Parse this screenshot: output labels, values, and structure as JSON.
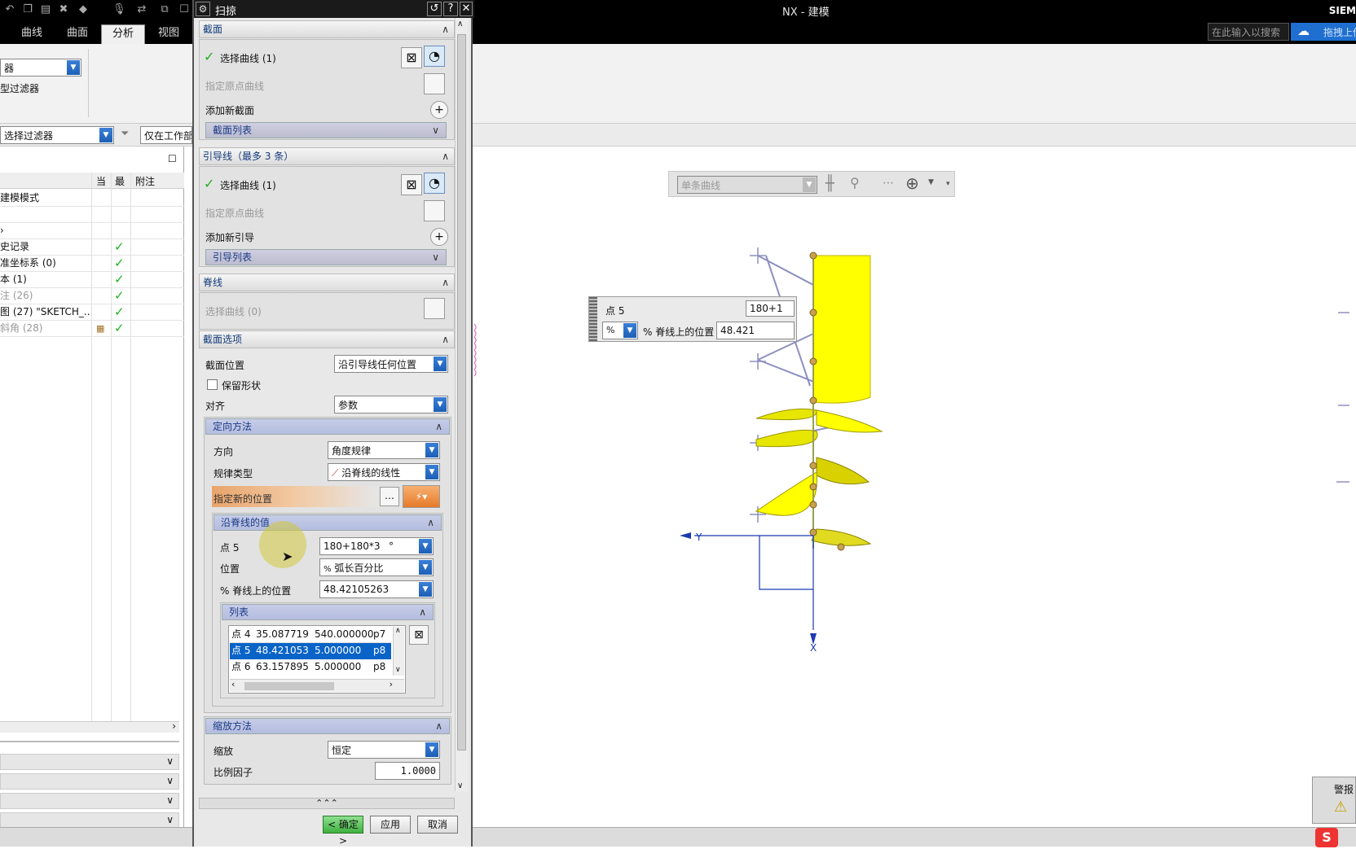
{
  "window": {
    "app_title": "NX - 建模",
    "brand": "SIEM",
    "search_placeholder": "在此输入以搜索",
    "cloud_label": "拖拽上传"
  },
  "ribbon": {
    "tabs": [
      {
        "label": "曲线",
        "active": false
      },
      {
        "label": "曲面",
        "active": false
      },
      {
        "label": "分析",
        "active": true
      },
      {
        "label": "视图",
        "active": false
      }
    ],
    "filter_combo": "器",
    "type_filter_label": "型过滤器",
    "select_filter_combo": "选择过滤器",
    "work_part_combo": "仅在工作部件"
  },
  "navigator": {
    "columns": [
      "当",
      "最",
      "附注"
    ],
    "rows": [
      {
        "label": "建模模式",
        "check": "",
        "dim": false
      },
      {
        "label": "",
        "check": "",
        "dim": false
      },
      {
        "label": "›",
        "check": "",
        "dim": false
      },
      {
        "label": "史记录",
        "check": "✓",
        "dim": false
      },
      {
        "label": "准坐标系 (0)",
        "check": "✓",
        "dim": false
      },
      {
        "label": "本 (1)",
        "check": "✓",
        "dim": false
      },
      {
        "label": "注 (26)",
        "check": "✓",
        "dim": true
      },
      {
        "label": "图 (27) \"SKETCH_...",
        "check": "✓",
        "dim": false
      },
      {
        "label": "斜角 (28)",
        "check": "✓",
        "dim": true
      }
    ]
  },
  "dialog": {
    "title": "扫掠",
    "section_profile": {
      "header": "截面",
      "select_curve": "选择曲线 (1)",
      "specify_origin": "指定原点曲线",
      "add_new": "添加新截面",
      "list": "截面列表"
    },
    "section_guide": {
      "header": "引导线（最多 3 条）",
      "select_curve": "选择曲线 (1)",
      "specify_origin": "指定原点曲线",
      "add_new": "添加新引导",
      "list": "引导列表"
    },
    "section_spine": {
      "header": "脊线",
      "select_curve": "选择曲线 (0)"
    },
    "section_options": {
      "header": "截面选项",
      "position_label": "截面位置",
      "position_value": "沿引导线任何位置",
      "preserve_shape": "保留形状",
      "align_label": "对齐",
      "align_value": "参数",
      "orientation": {
        "header": "定向方法",
        "direction_label": "方向",
        "direction_value": "角度规律",
        "law_type_label": "规律类型",
        "law_type_value": "沿脊线的线性",
        "specify_new_location": "指定新的位置",
        "spine_values": {
          "header": "沿脊线的值",
          "point_label": "点 5",
          "point_value": "180+180*3",
          "point_unit": "°",
          "location_label": "位置",
          "location_value": "弧长百分比",
          "percent_label": "% 脊线上的位置",
          "percent_value": "48.42105263",
          "list": {
            "header": "列表",
            "rows": [
              {
                "name": "点 4",
                "pos": "35.087719",
                "value": "540.000000",
                "expr": "p7",
                "selected": false
              },
              {
                "name": "点 5",
                "pos": "48.421053",
                "value": "5.000000",
                "expr": "p8",
                "selected": true
              },
              {
                "name": "点 6",
                "pos": "63.157895",
                "value": "5.000000",
                "expr": "p8",
                "selected": false
              }
            ]
          }
        }
      }
    },
    "scaling": {
      "header": "缩放方法",
      "scale_label": "缩放",
      "scale_value": "恒定",
      "factor_label": "比例因子",
      "factor_value": "1.0000"
    },
    "buttons": {
      "ok": "< 确定 >",
      "apply": "应用",
      "cancel": "取消"
    }
  },
  "graphics": {
    "filter_combo": "单条曲线",
    "popup": {
      "point_label": "点 5",
      "point_value": "180+1",
      "percent_label": "% 脊线上的位置",
      "percent_value": "48.421"
    },
    "axis_y": "Y",
    "axis_x": "X",
    "warning_label": "警报"
  },
  "colors": {
    "surface": "#ffff00",
    "accent": "#1d5fb6",
    "selection": "#0a64c8"
  }
}
